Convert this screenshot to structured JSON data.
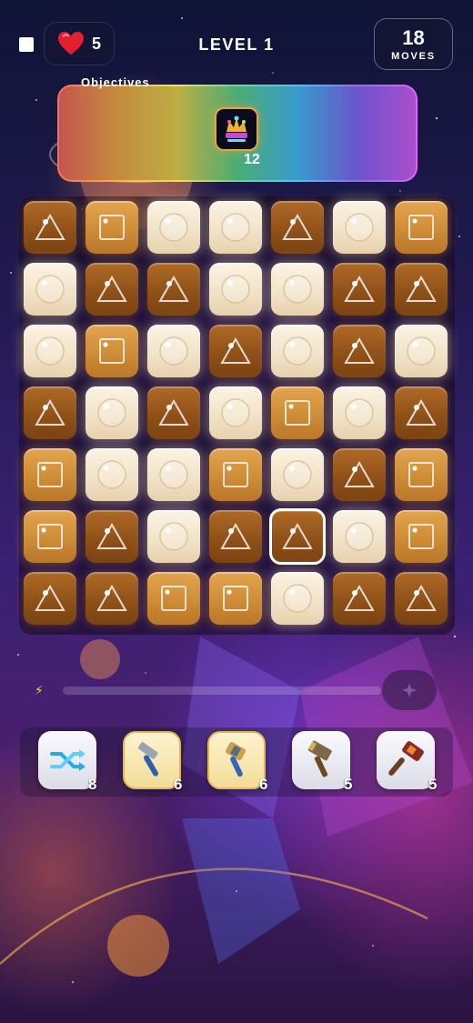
{
  "header": {
    "lives": "5",
    "level_title": "LEVEL 1",
    "moves_value": "18",
    "moves_label": "MOVES"
  },
  "objectives": {
    "label": "Objectives",
    "item_icon": "gem-crown-badge-icon",
    "item_count": "12"
  },
  "board": {
    "rows": 7,
    "cols": 7,
    "selected": [
      5,
      4
    ],
    "legend": {
      "A": "dark-triangle",
      "B": "mid-square",
      "C": "light-circle"
    },
    "grid": [
      [
        "A",
        "B",
        "C",
        "C",
        "A",
        "C",
        "B"
      ],
      [
        "C",
        "A",
        "A",
        "C",
        "C",
        "A",
        "A"
      ],
      [
        "C",
        "B",
        "C",
        "A",
        "C",
        "A",
        "C"
      ],
      [
        "A",
        "C",
        "A",
        "C",
        "B",
        "C",
        "A"
      ],
      [
        "B",
        "C",
        "C",
        "B",
        "C",
        "A",
        "B"
      ],
      [
        "B",
        "A",
        "C",
        "A",
        "A",
        "C",
        "B"
      ],
      [
        "A",
        "A",
        "B",
        "B",
        "C",
        "A",
        "A"
      ]
    ]
  },
  "power_meter": {
    "icon": "lightning-bolt-icon",
    "fill_fraction": 0.0
  },
  "boosters": [
    {
      "icon": "shuffle-arrows-icon",
      "count": "8",
      "active": false
    },
    {
      "icon": "hammer-icon",
      "count": "6",
      "active": true
    },
    {
      "icon": "mallet-icon",
      "count": "6",
      "active": true
    },
    {
      "icon": "war-hammer-icon",
      "count": "5",
      "active": false
    },
    {
      "icon": "sledgehammer-icon",
      "count": "5",
      "active": false
    }
  ],
  "colors": {
    "tile_dark": "#8d4f18",
    "tile_mid": "#cc8a35",
    "tile_light": "#f1e2c6",
    "accent_gold": "#e7b64b"
  }
}
